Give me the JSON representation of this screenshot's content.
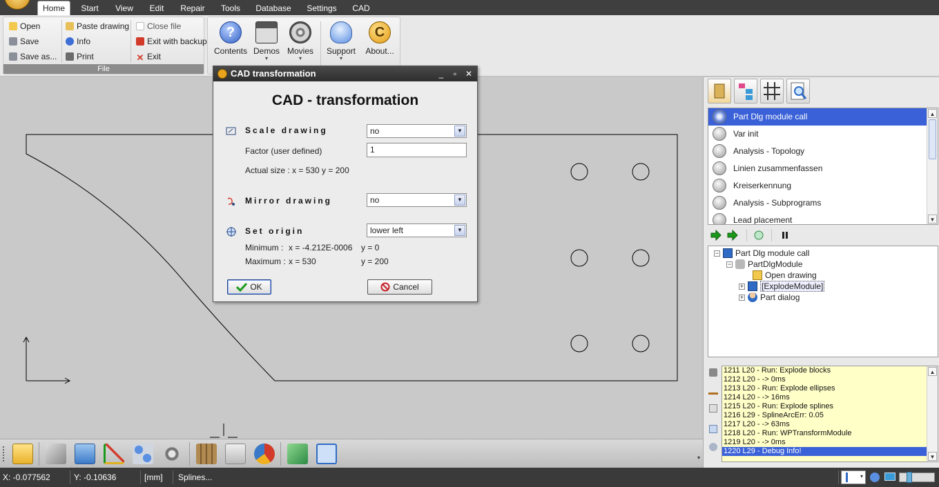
{
  "menubar": {
    "tabs": [
      "Home",
      "Start",
      "View",
      "Edit",
      "Repair",
      "Tools",
      "Database",
      "Settings",
      "CAD"
    ],
    "active": "Home"
  },
  "ribbon": {
    "file_group": {
      "caption": "File",
      "col1": [
        "Open",
        "Save",
        "Save as..."
      ],
      "col2": [
        "Paste drawing",
        "Info",
        "Print"
      ],
      "col3": [
        "Close file",
        "Exit with backup",
        "Exit"
      ]
    },
    "help_buttons": [
      "Contents",
      "Demos",
      "Movies",
      "Support",
      "About..."
    ]
  },
  "dialog": {
    "title": "CAD transformation",
    "heading": "CAD - transformation",
    "scale": {
      "label": "Scale drawing",
      "value": "no",
      "factor_label": "Factor (user defined)",
      "factor_value": "1",
      "actual_size": "Actual size :   x = 530   y = 200"
    },
    "mirror": {
      "label": "Mirror drawing",
      "value": "no"
    },
    "origin": {
      "label": "Set origin",
      "value": "lower left",
      "minimum_label": "Minimum   :",
      "minimum_x": "x = -4.212E-0006",
      "minimum_y": "y = 0",
      "maximum_label": "Maximum  :",
      "maximum_x": "x = 530",
      "maximum_y": "y = 200"
    },
    "ok_label": "OK",
    "cancel_label": "Cancel"
  },
  "steps": [
    "Part Dlg module call",
    "Var init",
    "Analysis - Topology",
    "Linien zusammenfassen",
    "Kreiserkennung",
    "Analysis - Subprograms",
    "Lead placement"
  ],
  "tree": {
    "root": "Part Dlg module call",
    "module": "PartDlgModule",
    "open_drawing": "Open drawing",
    "explode": "[ExplodeModule]",
    "part_dialog": "Part dialog"
  },
  "log": [
    "1211 L20 - Run: Explode blocks",
    "1212 L20 -  -> 0ms",
    "1213 L20 - Run: Explode ellipses",
    "1214 L20 -  -> 16ms",
    "1215 L20 - Run: Explode splines",
    "1216 L29 - SplineArcErr: 0.05",
    "1217 L20 -  -> 63ms",
    "1218 L20 - Run: WPTransformModule",
    "1219 L20 -  -> 0ms",
    "1220 L29 - Debug Info!"
  ],
  "status": {
    "x": "X: -0.077562",
    "y": "Y: -0.10636",
    "unit": "[mm]",
    "message": "Splines..."
  },
  "colors": {
    "selection": "#3a61d8",
    "log_background": "#ffffc8",
    "menubar": "#3f3f3f",
    "canvas": "#c9c9c9"
  }
}
